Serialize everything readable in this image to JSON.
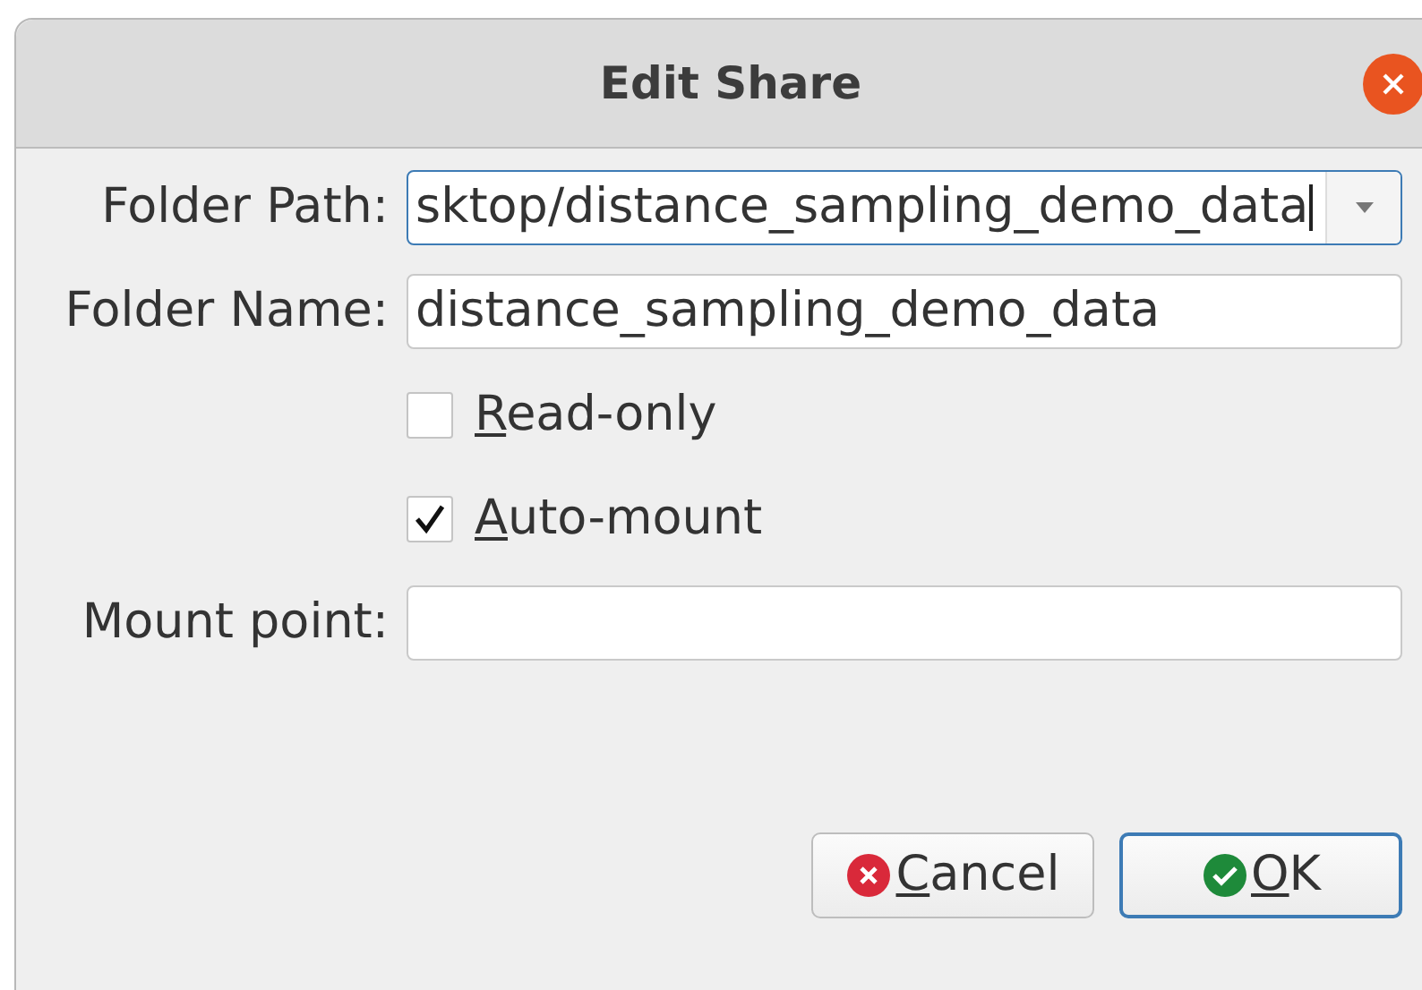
{
  "window": {
    "title": "Edit Share"
  },
  "fields": [
    {
      "kind": "combo",
      "label": "Folder Path:",
      "value": "sktop/distance_sampling_demo_data",
      "focused": true
    },
    {
      "kind": "text",
      "label": "Folder Name:",
      "value": "distance_sampling_demo_data",
      "focused": false
    },
    {
      "kind": "checkbox",
      "label": "Read-only",
      "checked": false
    },
    {
      "kind": "checkbox",
      "label": "Auto-mount",
      "checked": true
    },
    {
      "kind": "text",
      "label": "Mount point:",
      "focused": false
    }
  ],
  "buttons": [
    {
      "kind": "cancel",
      "label": "Cancel",
      "selected": false
    },
    {
      "kind": "ok",
      "label": "OK",
      "selected": true
    }
  ]
}
